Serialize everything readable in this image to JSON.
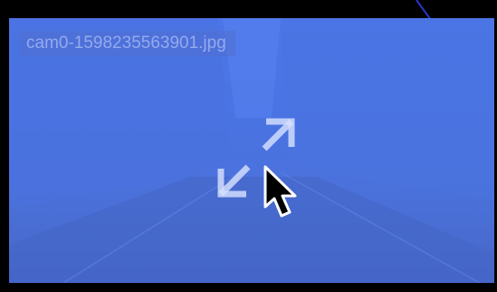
{
  "viewer": {
    "filename": "cam0-1598235563901.jpg",
    "background_color": "#4b72dc"
  },
  "icons": {
    "expand": "fullscreen-expand-icon",
    "cursor": "mouse-pointer-icon"
  }
}
